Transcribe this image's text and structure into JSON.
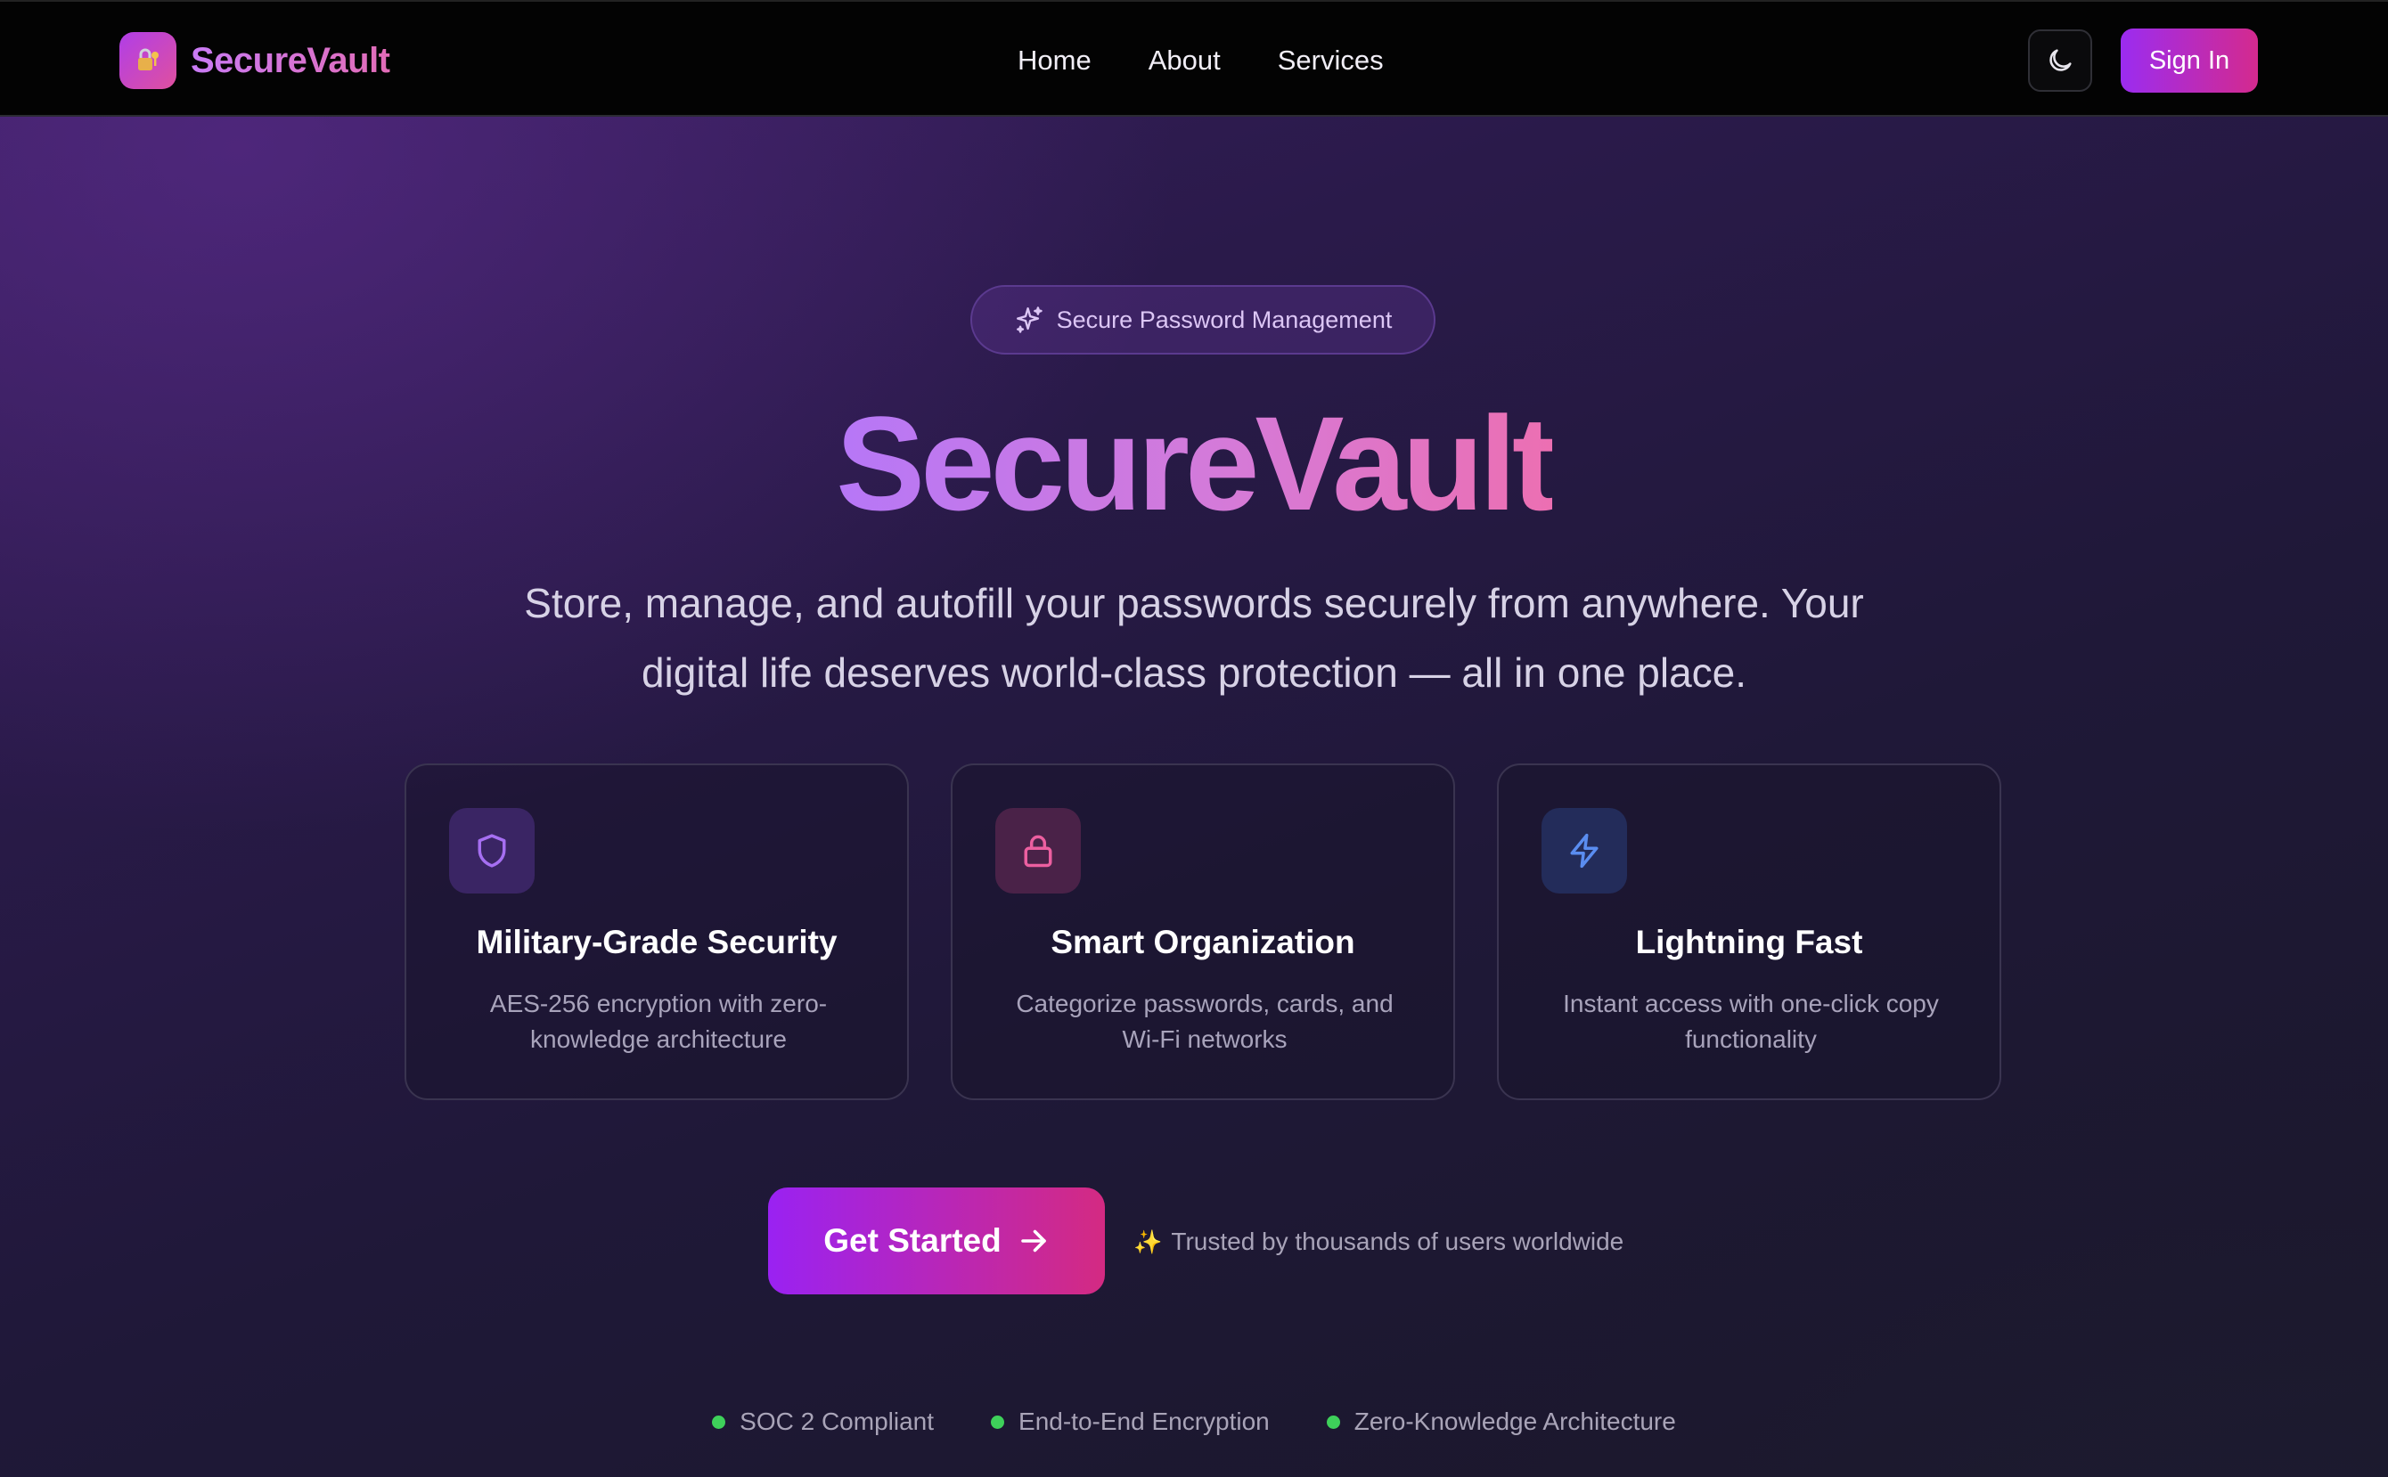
{
  "nav": {
    "brand": "SecureVault",
    "links": [
      {
        "label": "Home"
      },
      {
        "label": "About"
      },
      {
        "label": "Services"
      }
    ],
    "theme_toggle_icon": "moon-icon",
    "sign_in_label": "Sign In"
  },
  "hero": {
    "pill_label": "Secure Password Management",
    "pill_icon": "sparkles-icon",
    "title": "SecureVault",
    "subtitle_line1": "Store, manage, and autofill your passwords securely from anywhere. Your",
    "subtitle_line2": "digital life deserves world-class protection — all in one place."
  },
  "features": [
    {
      "icon": "shield-icon",
      "title": "Military-Grade Security",
      "desc_line1": "AES-256 encryption with zero-",
      "desc_line2": "knowledge architecture",
      "accent": "#a66ff2"
    },
    {
      "icon": "lock-icon",
      "title": "Smart Organization",
      "desc_line1": "Categorize passwords, cards, and",
      "desc_line2": "Wi-Fi networks",
      "accent": "#ec5fa0"
    },
    {
      "icon": "lightning-icon",
      "title": "Lightning Fast",
      "desc_line1": "Instant access with one-click copy",
      "desc_line2": "functionality",
      "accent": "#5a8df0"
    }
  ],
  "cta": {
    "button_label": "Get Started",
    "trusted_emoji": "✨",
    "trusted_text": "Trusted by thousands of users worldwide"
  },
  "badges": [
    {
      "label": "SOC 2 Compliant"
    },
    {
      "label": "End-to-End Encryption"
    },
    {
      "label": "Zero-Knowledge Architecture"
    }
  ],
  "colors": {
    "brand_gradient_start": "#9a22f2",
    "brand_gradient_end": "#d42a82",
    "status_green": "#3ed05a"
  }
}
